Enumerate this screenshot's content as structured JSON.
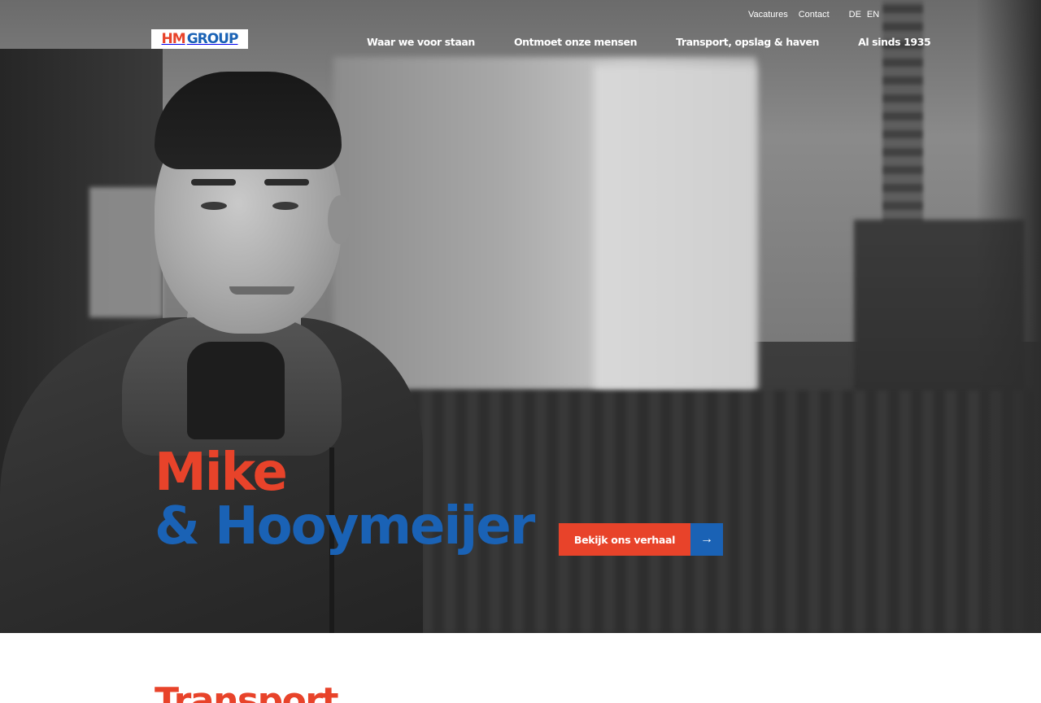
{
  "brand": {
    "logo_part1": "HM",
    "logo_part2": "GROUP",
    "accent_red": "#e8432a",
    "accent_blue": "#1a62b5"
  },
  "top_links": {
    "vacatures": "Vacatures",
    "contact": "Contact",
    "lang_de": "DE",
    "lang_en": "EN"
  },
  "nav": {
    "items": [
      "Waar we voor staan",
      "Ontmoet onze mensen",
      "Transport, opslag & haven",
      "Al sinds 1935"
    ]
  },
  "hero": {
    "line1": "Mike",
    "line2": "& Hooymeijer",
    "cta_label": "Bekijk ons verhaal",
    "cta_icon": "arrow-right-icon",
    "cta_arrow": "→"
  },
  "next_section": {
    "title_peek": "Transport"
  }
}
